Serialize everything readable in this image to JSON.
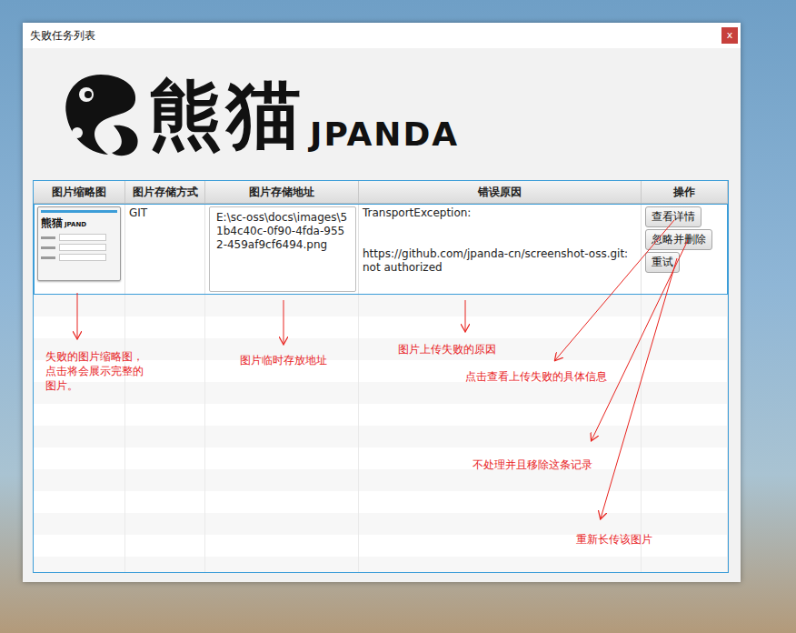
{
  "window": {
    "title": "失败任务列表",
    "close": "x"
  },
  "logo": {
    "name": "熊猫",
    "latin": "JPANDA"
  },
  "table": {
    "columns": [
      "图片缩略图",
      "图片存储方式",
      "图片存储地址",
      "错误原因",
      "操作"
    ],
    "rows": [
      {
        "selected": true,
        "thumbnail": {
          "name": "熊猫",
          "latin": "JPAND"
        },
        "storage": "GIT",
        "path": "E:\\sc-oss\\docs\\images\\51b4c40c-0f90-4fda-9552-459af9cf6494.png",
        "error": {
          "title": "TransportException:",
          "detail": "https://github.com/jpanda-cn/screenshot-oss.git: not authorized"
        },
        "actions": [
          "查看详情",
          "忽略并删除",
          "重试"
        ]
      }
    ]
  },
  "annotations": [
    {
      "text": "失败的图片缩略图，点击将会展示完整的图片。"
    },
    {
      "text": "图片临时存放地址"
    },
    {
      "text": "图片上传失败的原因"
    },
    {
      "text": "点击查看上传失败的具体信息"
    },
    {
      "text": "不处理并且移除这条记录"
    },
    {
      "text": "重新长传该图片"
    }
  ]
}
